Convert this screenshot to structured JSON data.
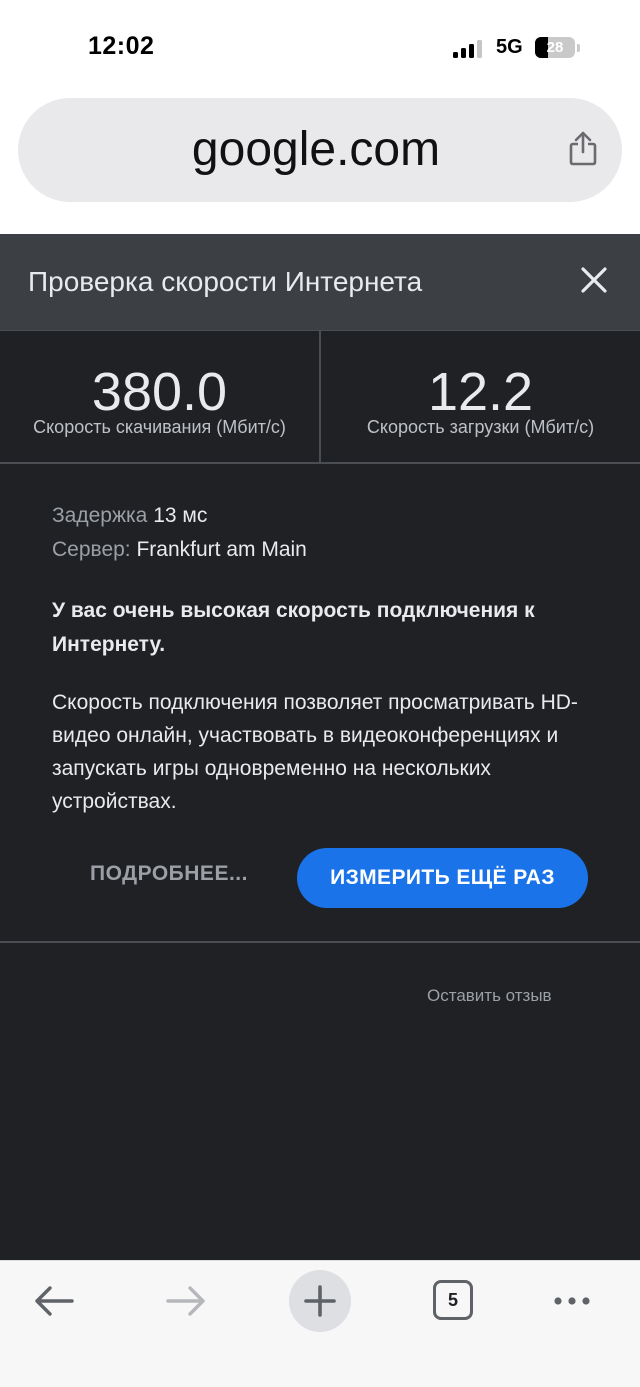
{
  "status_bar": {
    "time": "12:02",
    "network": "5G",
    "battery_level": "28"
  },
  "url_bar": {
    "url": "google.com",
    "share_icon": "share-icon"
  },
  "speed_test": {
    "title": "Проверка скорости Интернета",
    "close_icon": "close-icon",
    "download": {
      "value": "380.0",
      "label": "Скорость скачивания (Мбит/с)"
    },
    "upload": {
      "value": "12.2",
      "label": "Скорость загрузки (Мбит/с)"
    },
    "latency": {
      "key": "Задержка",
      "value": "13 мс"
    },
    "server": {
      "key": "Сервер:",
      "value": "Frankfurt am Main"
    },
    "verdict": "У вас очень высокая скорость подключения к Интернету.",
    "description": "Скорость подключения позволяет просматривать HD-видео онлайн, участвовать в видеоконференциях и запускать игры одновременно на нескольких устройствах.",
    "more_label": "ПОДРОБНЕЕ...",
    "retest_label": "ИЗМЕРИТЬ ЕЩЁ РАЗ",
    "feedback_label": "Оставить отзыв"
  },
  "toolbar": {
    "tab_count": "5",
    "icons": [
      "back-arrow-icon",
      "forward-arrow-icon",
      "plus-icon",
      "tabs-icon",
      "more-dots-icon"
    ]
  },
  "colors": {
    "panel_bg": "#202124",
    "header_bg": "#3c3f43",
    "accent": "#1a73e8"
  }
}
